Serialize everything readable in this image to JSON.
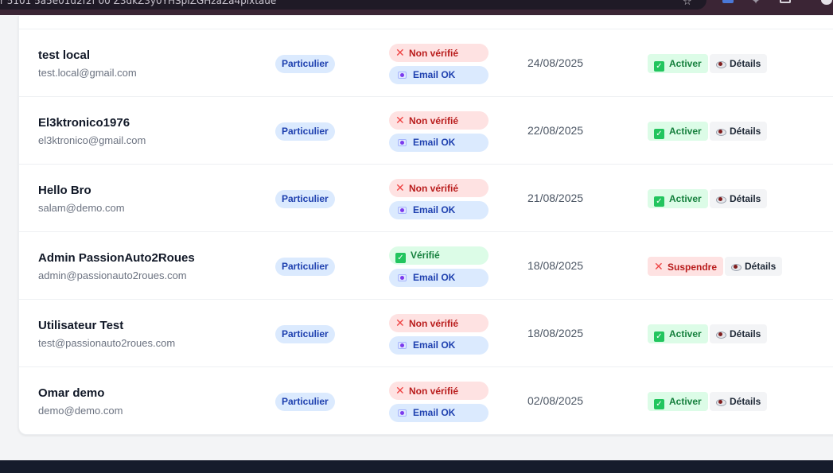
{
  "browser": {
    "url_fragment": "r 5101 5a5e01d2f2f 00 Z3dkZ3y0YHSpIZGHzaZa4pixtaue"
  },
  "colors": {
    "verified_green": "#22c55e",
    "unverified_red": "#ef4444",
    "badge_blue": "#dbeafe",
    "footer_dark": "#161c2c"
  },
  "table": {
    "rows": [
      {
        "name": "test local",
        "email": "test.local@gmail.com",
        "type": "Particulier",
        "verification": "Non vérifié",
        "verified": false,
        "email_status": "Email OK",
        "date": "24/08/2025",
        "action": "Activer",
        "details": "Détails"
      },
      {
        "name": "El3ktronico1976",
        "email": "el3ktronico@gmail.com",
        "type": "Particulier",
        "verification": "Non vérifié",
        "verified": false,
        "email_status": "Email OK",
        "date": "22/08/2025",
        "action": "Activer",
        "details": "Détails"
      },
      {
        "name": "Hello Bro",
        "email": "salam@demo.com",
        "type": "Particulier",
        "verification": "Non vérifié",
        "verified": false,
        "email_status": "Email OK",
        "date": "21/08/2025",
        "action": "Activer",
        "details": "Détails"
      },
      {
        "name": "Admin PassionAuto2Roues",
        "email": "admin@passionauto2roues.com",
        "type": "Particulier",
        "verification": "Vérifié",
        "verified": true,
        "email_status": "Email OK",
        "date": "18/08/2025",
        "action": "Suspendre",
        "details": "Détails"
      },
      {
        "name": "Utilisateur Test",
        "email": "test@passionauto2roues.com",
        "type": "Particulier",
        "verification": "Non vérifié",
        "verified": false,
        "email_status": "Email OK",
        "date": "18/08/2025",
        "action": "Activer",
        "details": "Détails"
      },
      {
        "name": "Omar demo",
        "email": "demo@demo.com",
        "type": "Particulier",
        "verification": "Non vérifié",
        "verified": false,
        "email_status": "Email OK",
        "date": "02/08/2025",
        "action": "Activer",
        "details": "Détails"
      }
    ]
  }
}
